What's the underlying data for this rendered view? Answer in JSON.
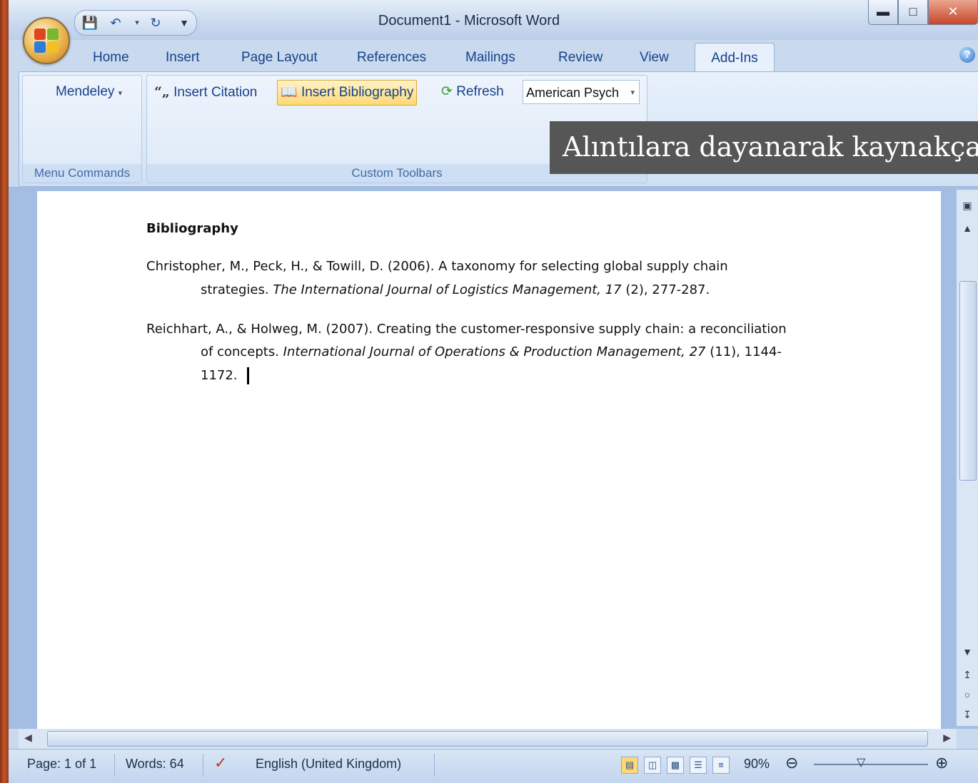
{
  "window": {
    "title": "Document1 - Microsoft Word"
  },
  "tabs": [
    "Home",
    "Insert",
    "Page Layout",
    "References",
    "Mailings",
    "Review",
    "View",
    "Add-Ins"
  ],
  "active_tab": "Add-Ins",
  "ribbon": {
    "mendeley_label": "Mendeley",
    "menu_group_label": "Menu Commands",
    "insert_citation": "Insert Citation",
    "insert_bibliography": "Insert Bibliography",
    "refresh": "Refresh",
    "style_value": "American Psych",
    "custom_group_label": "Custom Toolbars"
  },
  "tooltip": "Alıntılara dayanarak kaynakçay",
  "document": {
    "heading": "Bibliography",
    "entry1_line1": "Christopher, M., Peck, H., & Towill, D. (2006). A taxonomy for selecting global supply chain",
    "entry1_line2_plain": "strategies. ",
    "entry1_line2_italic": "The International Journal of Logistics Management, 17",
    "entry1_line2_tail": " (2), 277-287.",
    "entry2_line1": "Reichhart, A., & Holweg, M. (2007). Creating the customer-responsive supply chain: a reconciliation",
    "entry2_line2_plain": "of concepts. ",
    "entry2_line2_italic": "International Journal of Operations & Production Management, 27",
    "entry2_line2_tail": " (11), 1144-",
    "entry2_line3": "1172."
  },
  "status": {
    "page": "Page: 1 of 1",
    "words": "Words: 64",
    "language": "English (United Kingdom)",
    "zoom": "90%"
  }
}
